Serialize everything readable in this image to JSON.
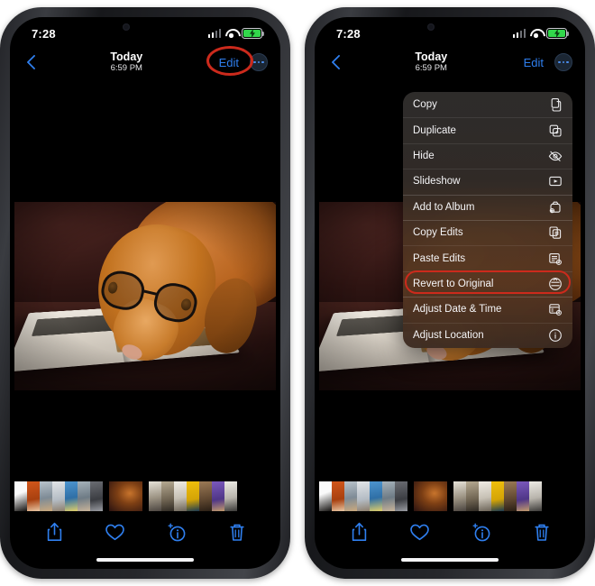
{
  "status_bar": {
    "time": "7:28",
    "cellular_icon": "cellular-bars-icon",
    "wifi_icon": "wifi-icon",
    "battery_icon": "battery-charging-icon"
  },
  "nav": {
    "back_icon": "back-chevron-icon",
    "title": "Today",
    "subtitle": "6:59 PM",
    "edit_label": "Edit",
    "more_icon": "more-options-icon"
  },
  "photo": {
    "description": "dog-wearing-glasses-reading-magazine"
  },
  "toolbar": {
    "items": [
      {
        "name": "share-icon",
        "label": "Share"
      },
      {
        "name": "favorite-heart-icon",
        "label": "Favorite"
      },
      {
        "name": "info-sparkle-icon",
        "label": "Info"
      },
      {
        "name": "trash-icon",
        "label": "Delete"
      }
    ]
  },
  "context_menu": {
    "items": [
      {
        "label": "Copy",
        "icon": "copy-icon",
        "separator": false
      },
      {
        "label": "Duplicate",
        "icon": "duplicate-icon",
        "separator": false
      },
      {
        "label": "Hide",
        "icon": "eye-slash-icon",
        "separator": false
      },
      {
        "label": "Slideshow",
        "icon": "slideshow-play-icon",
        "separator": false
      },
      {
        "label": "Add to Album",
        "icon": "add-to-album-icon",
        "separator": true
      },
      {
        "label": "Copy Edits",
        "icon": "copy-edits-icon",
        "separator": true
      },
      {
        "label": "Paste Edits",
        "icon": "paste-edits-icon",
        "separator": false
      },
      {
        "label": "Revert to Original",
        "icon": "revert-icon",
        "separator": false
      },
      {
        "label": "Adjust Date & Time",
        "icon": "calendar-clock-icon",
        "separator": true
      },
      {
        "label": "Adjust Location",
        "icon": "location-info-icon",
        "separator": false
      }
    ]
  },
  "annotations": {
    "edit_highlight_color": "#cc2a1c",
    "revert_highlight_color": "#cc2a1c"
  },
  "colors": {
    "accent_blue": "#2f7fef",
    "battery_green": "#32d74b",
    "screen_black": "#000000",
    "page_background": "#ffffff"
  },
  "filmstrip": {
    "thumbs_left": [
      "#16140f",
      "#c9531c",
      "#8d9aa4",
      "#c7cbd0",
      "#3f88c5",
      "#93a3ac",
      "#4a4b50"
    ],
    "selected_thumb": "#3a1d17",
    "thumbs_right": [
      "#cfcabc",
      "#8b8272",
      "#e8e4dc",
      "#e8b50b",
      "#7d6248",
      "#6a4bb0",
      "#dcd8d0"
    ]
  }
}
